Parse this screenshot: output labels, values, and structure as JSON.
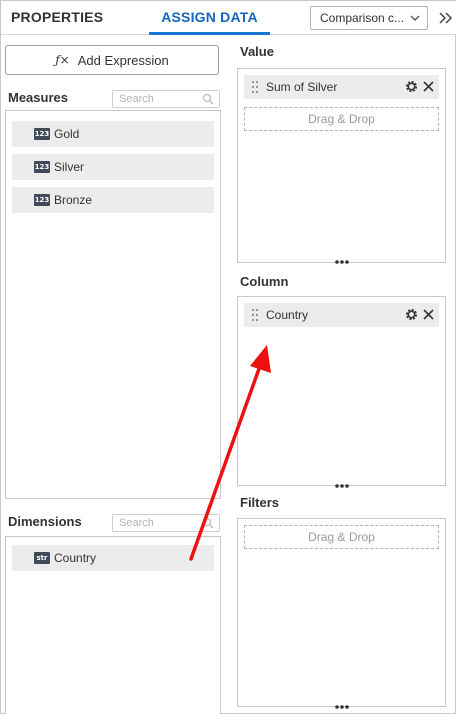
{
  "header": {
    "tabs": [
      {
        "label": "PROPERTIES",
        "active": false
      },
      {
        "label": "ASSIGN DATA",
        "active": true
      }
    ],
    "widget_select": {
      "value": "Comparison c..."
    },
    "collapse_icon": "double-chevron-right-icon"
  },
  "left": {
    "add_expression": {
      "label": "Add Expression",
      "icon": "fx-icon"
    },
    "measures": {
      "title": "Measures",
      "search_placeholder": "Search",
      "items": [
        {
          "type": "123",
          "label": "Gold"
        },
        {
          "type": "123",
          "label": "Silver"
        },
        {
          "type": "123",
          "label": "Bronze"
        }
      ]
    },
    "dimensions": {
      "title": "Dimensions",
      "search_placeholder": "Search",
      "items": [
        {
          "type": "str",
          "label": "Country"
        }
      ]
    }
  },
  "right": {
    "value": {
      "title": "Value",
      "items": [
        {
          "label": "Sum of Silver"
        }
      ],
      "drop_text": "Drag & Drop"
    },
    "column": {
      "title": "Column",
      "items": [
        {
          "label": "Country"
        }
      ]
    },
    "filters": {
      "title": "Filters",
      "drop_text": "Drag & Drop"
    }
  },
  "colors": {
    "accent": "#1976d2",
    "annotation_arrow": "#ee1111",
    "item_background": "#ececec",
    "badge": "#3f4a5a"
  }
}
